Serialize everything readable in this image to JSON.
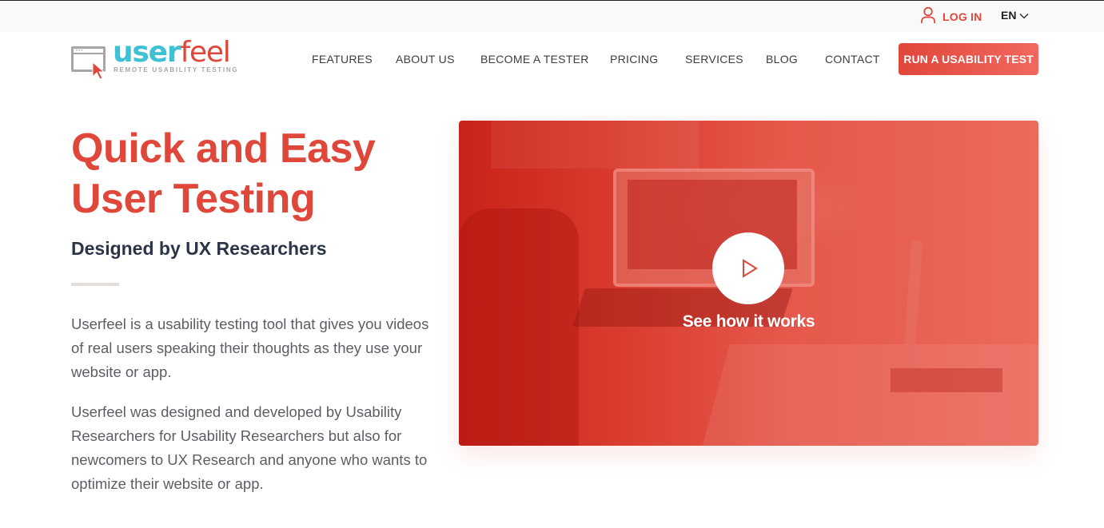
{
  "topbar": {
    "login_label": "LOG IN",
    "language": "EN"
  },
  "logo": {
    "word_part1": "user",
    "word_part2": "feel",
    "tagline": "REMOTE USABILITY TESTING"
  },
  "nav": {
    "items": [
      {
        "label": "FEATURES"
      },
      {
        "label": "ABOUT US"
      },
      {
        "label": "BECOME A TESTER"
      },
      {
        "label": "PRICING"
      },
      {
        "label": "SERVICES"
      },
      {
        "label": "BLOG"
      },
      {
        "label": "CONTACT"
      }
    ],
    "cta_label": "RUN A USABILITY TEST"
  },
  "hero": {
    "title_line1": "Quick and Easy",
    "title_line2": "User Testing",
    "subtitle": "Designed by UX Researchers",
    "paragraph1": "Userfeel is a usability testing tool that gives you videos of real users speaking their thoughts as they use your website or app.",
    "paragraph2": "Userfeel was designed and developed by Usability Researchers for Usability Researchers but also for newcomers to UX Research and anyone who wants to optimize their website or app."
  },
  "video": {
    "caption": "See how it works"
  },
  "colors": {
    "brand_red": "#e0473b",
    "brand_cyan": "#3ec1d3",
    "nav_text": "#3c3c44",
    "subtitle": "#2b3449",
    "body_text": "#5d5d66"
  }
}
